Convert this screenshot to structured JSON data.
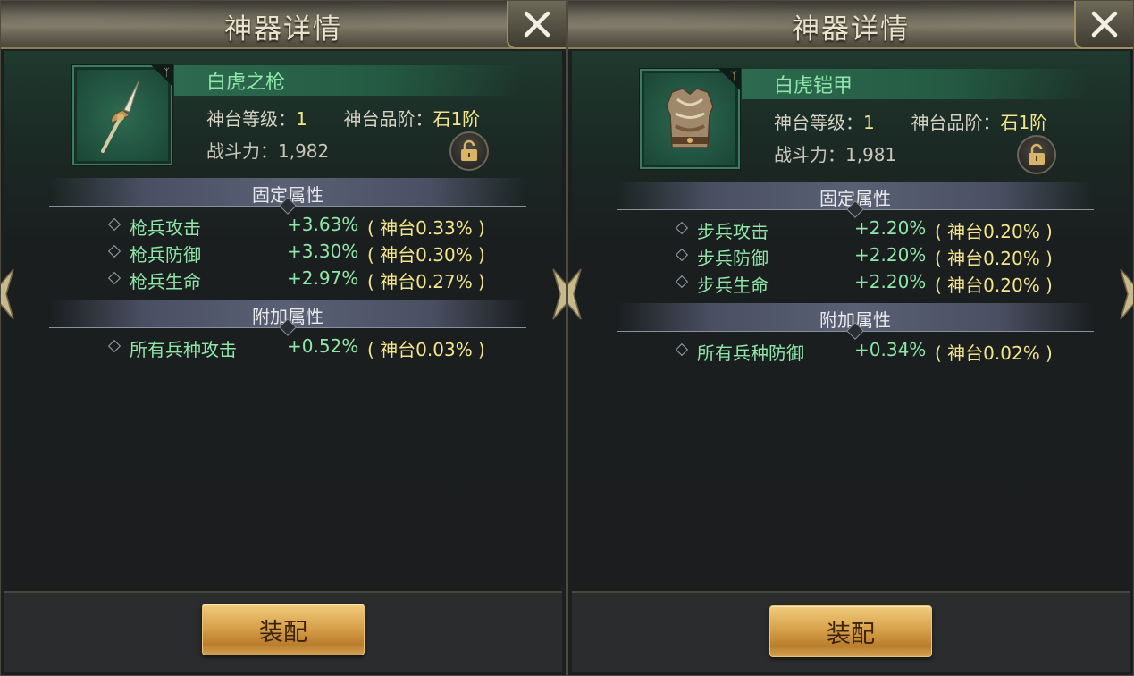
{
  "panels": [
    {
      "title": "神器详情",
      "item_name": "白虎之枪",
      "item_icon": "spear-icon",
      "level_label": "神台等级：",
      "level_value": "1",
      "grade_label": "神台品阶：",
      "grade_value": "石1阶",
      "power_label": "战斗力：",
      "power_value": "1,982",
      "fixed_header": "固定属性",
      "fixed_attrs": [
        {
          "name": "枪兵攻击",
          "value": "+3.63%",
          "base": "( 神台0.33% )"
        },
        {
          "name": "枪兵防御",
          "value": "+3.30%",
          "base": "( 神台0.30% )"
        },
        {
          "name": "枪兵生命",
          "value": "+2.97%",
          "base": "( 神台0.27% )"
        }
      ],
      "extra_header": "附加属性",
      "extra_attrs": [
        {
          "name": "所有兵种攻击",
          "value": "+0.52%",
          "base": "( 神台0.03% )"
        }
      ],
      "equip_label": "装配"
    },
    {
      "title": "神器详情",
      "item_name": "白虎铠甲",
      "item_icon": "armor-icon",
      "level_label": "神台等级：",
      "level_value": "1",
      "grade_label": "神台品阶：",
      "grade_value": "石1阶",
      "power_label": "战斗力：",
      "power_value": "1,981",
      "fixed_header": "固定属性",
      "fixed_attrs": [
        {
          "name": "步兵攻击",
          "value": "+2.20%",
          "base": "( 神台0.20% )"
        },
        {
          "name": "步兵防御",
          "value": "+2.20%",
          "base": "( 神台0.20% )"
        },
        {
          "name": "步兵生命",
          "value": "+2.20%",
          "base": "( 神台0.20% )"
        }
      ],
      "extra_header": "附加属性",
      "extra_attrs": [
        {
          "name": "所有兵种防御",
          "value": "+0.34%",
          "base": "( 神台0.02% )"
        }
      ],
      "equip_label": "装配"
    }
  ],
  "colors": {
    "attr_green": "#8ee6a8",
    "value_yellow": "#f3e58a",
    "button_gold": "#d9a24c"
  }
}
